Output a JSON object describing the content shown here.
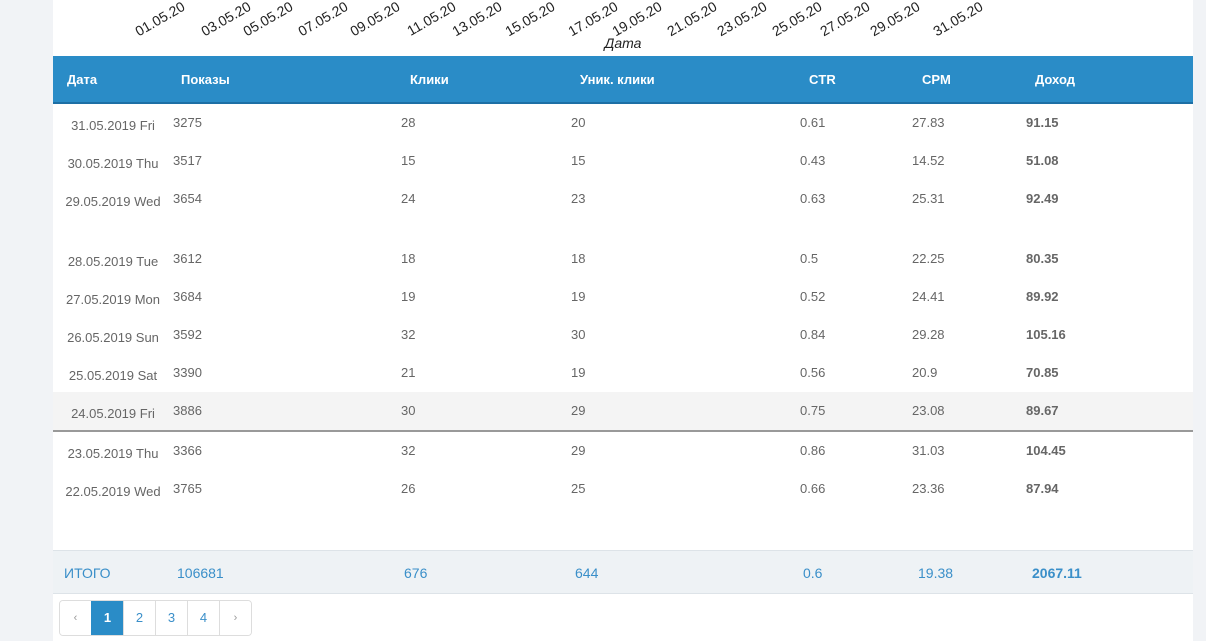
{
  "chart": {
    "xlabel": "Дата",
    "ticks": [
      "01.05.20",
      "03.05.20",
      "05.05.20",
      "07.05.20",
      "09.05.20",
      "11.05.20",
      "13.05.20",
      "15.05.20",
      "17.05.20",
      "19.05.20",
      "21.05.20",
      "23.05.20",
      "25.05.20",
      "27.05.20",
      "29.05.20",
      "31.05.20"
    ]
  },
  "table": {
    "headers": [
      "Дата",
      "Показы",
      "Клики",
      "Уник. клики",
      "CTR",
      "CPM",
      "Доход"
    ],
    "rows": [
      [
        "31.05.2019 Fri",
        "3275",
        "28",
        "20",
        "0.61",
        "27.83",
        "91.15"
      ],
      [
        "30.05.2019 Thu",
        "3517",
        "15",
        "15",
        "0.43",
        "14.52",
        "51.08"
      ],
      [
        "29.05.2019 Wed",
        "3654",
        "24",
        "23",
        "0.63",
        "25.31",
        "92.49"
      ],
      [
        "28.05.2019 Tue",
        "3612",
        "18",
        "18",
        "0.5",
        "22.25",
        "80.35"
      ],
      [
        "27.05.2019 Mon",
        "3684",
        "19",
        "19",
        "0.52",
        "24.41",
        "89.92"
      ],
      [
        "26.05.2019 Sun",
        "3592",
        "32",
        "30",
        "0.84",
        "29.28",
        "105.16"
      ],
      [
        "25.05.2019 Sat",
        "3390",
        "21",
        "19",
        "0.56",
        "20.9",
        "70.85"
      ],
      [
        "24.05.2019 Fri",
        "3886",
        "30",
        "29",
        "0.75",
        "23.08",
        "89.67"
      ],
      [
        "23.05.2019 Thu",
        "3366",
        "32",
        "29",
        "0.86",
        "31.03",
        "104.45"
      ],
      [
        "22.05.2019 Wed",
        "3765",
        "26",
        "25",
        "0.66",
        "23.36",
        "87.94"
      ]
    ]
  },
  "totals": {
    "label": "ИТОГО",
    "impressions": "106681",
    "clicks": "676",
    "unique_clicks": "644",
    "ctr": "0.6",
    "cpm": "19.38",
    "income": "2067.11"
  },
  "pagination": {
    "prev": "‹",
    "pages": [
      "1",
      "2",
      "3",
      "4"
    ],
    "next": "›",
    "active_page": "1"
  },
  "colors": {
    "header_bg": "#2a8cc7",
    "totals_text": "#3a8fc9"
  }
}
